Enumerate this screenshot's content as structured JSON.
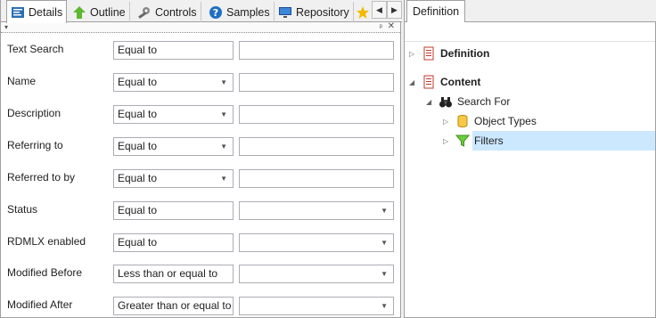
{
  "tabs": [
    {
      "label": "Details",
      "icon": "details-icon",
      "active": true
    },
    {
      "label": "Outline",
      "icon": "outline-icon"
    },
    {
      "label": "Controls",
      "icon": "controls-icon"
    },
    {
      "label": "Samples",
      "icon": "help-icon"
    },
    {
      "label": "Repository",
      "icon": "monitor-icon"
    },
    {
      "label": "",
      "icon": "star-icon"
    }
  ],
  "tab_scroll": {
    "left": "◀",
    "right": "▶"
  },
  "toolbar": {
    "dropdown": "▾",
    "pin": "ᵖ",
    "close": "✕"
  },
  "fields": [
    {
      "label": "Text Search",
      "operator": "Equal to",
      "op_dropdown": false,
      "value_dropdown": false
    },
    {
      "label": "Name",
      "operator": "Equal to",
      "op_dropdown": true,
      "value_dropdown": false
    },
    {
      "label": "Description",
      "operator": "Equal to",
      "op_dropdown": true,
      "value_dropdown": false
    },
    {
      "label": "Referring to",
      "operator": "Equal to",
      "op_dropdown": true,
      "value_dropdown": false
    },
    {
      "label": "Referred to by",
      "operator": "Equal to",
      "op_dropdown": true,
      "value_dropdown": false
    },
    {
      "label": "Status",
      "operator": "Equal to",
      "op_dropdown": false,
      "value_dropdown": true
    },
    {
      "label": "RDMLX enabled",
      "operator": "Equal to",
      "op_dropdown": false,
      "value_dropdown": true
    },
    {
      "label": "Modified Before",
      "operator": "Less than or equal to",
      "op_dropdown": false,
      "value_dropdown": true
    },
    {
      "label": "Modified After",
      "operator": "Greater than or equal to",
      "op_dropdown": false,
      "value_dropdown": true
    }
  ],
  "right_panel": {
    "tab": "Definition",
    "tree": [
      {
        "label": "Definition",
        "bold": true,
        "expander": "▷",
        "icon": "document-icon"
      },
      {
        "label": "Content",
        "bold": true,
        "expander": "◢",
        "icon": "document-icon"
      },
      {
        "label": "Search For",
        "bold": false,
        "expander": "◢",
        "icon": "binoculars-icon"
      },
      {
        "label": "Object Types",
        "bold": false,
        "expander": "▷",
        "icon": "database-icon"
      },
      {
        "label": "Filters",
        "bold": false,
        "expander": "▷",
        "icon": "funnel-icon",
        "selected": true
      }
    ]
  },
  "colors": {
    "selection": "#cce8ff",
    "border": "#a0a0a0",
    "input_border": "#abadb3"
  }
}
